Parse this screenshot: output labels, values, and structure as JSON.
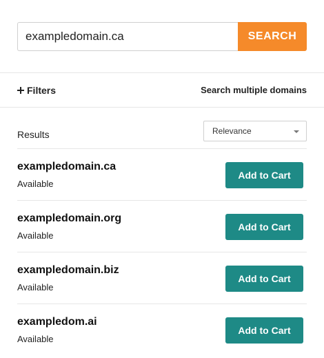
{
  "search": {
    "value": "exampledomain.ca",
    "button_label": "SEARCH"
  },
  "filters": {
    "toggle_label": "Filters",
    "multiple_domains_label": "Search multiple domains"
  },
  "results": {
    "label": "Results",
    "sort": {
      "selected": "Relevance"
    },
    "items": [
      {
        "domain": "exampledomain.ca",
        "status": "Available",
        "action_label": "Add to Cart"
      },
      {
        "domain": "exampledomain.org",
        "status": "Available",
        "action_label": "Add to Cart"
      },
      {
        "domain": "exampledomain.biz",
        "status": "Available",
        "action_label": "Add to Cart"
      },
      {
        "domain": "exampledom.ai",
        "status": "Available",
        "action_label": "Add to Cart"
      }
    ]
  },
  "colors": {
    "search_button": "#f58a2a",
    "cart_button": "#1e8a86"
  },
  "icons": {
    "filters": "plus-icon",
    "sort": "caret-down-icon"
  }
}
